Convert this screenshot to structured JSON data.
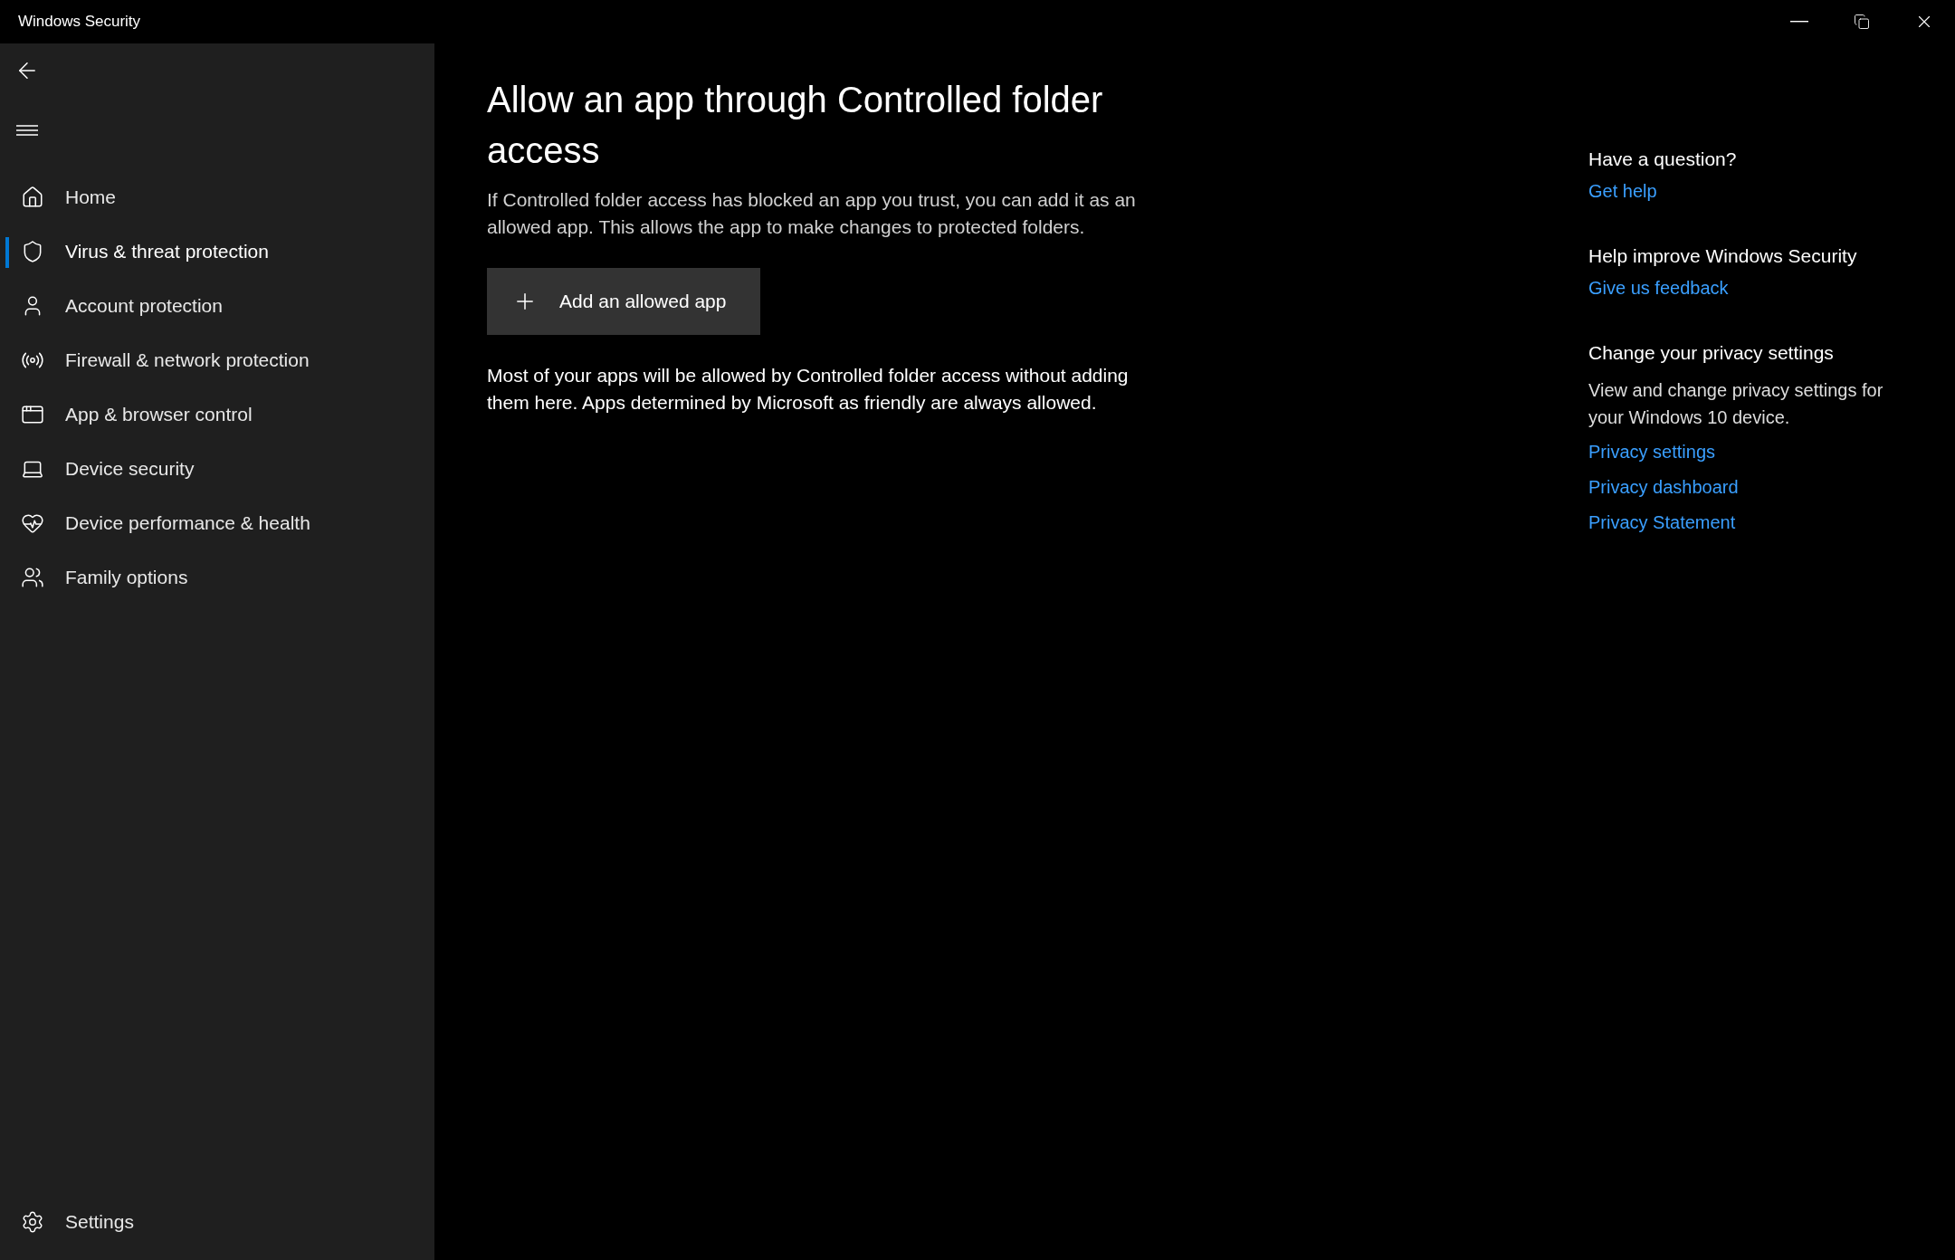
{
  "window": {
    "title": "Windows Security"
  },
  "sidebar": {
    "items": [
      {
        "label": "Home",
        "kind": "home",
        "selected": false
      },
      {
        "label": "Virus & threat protection",
        "kind": "shield",
        "selected": true
      },
      {
        "label": "Account protection",
        "kind": "person",
        "selected": false
      },
      {
        "label": "Firewall & network protection",
        "kind": "antenna",
        "selected": false
      },
      {
        "label": "App & browser control",
        "kind": "window",
        "selected": false
      },
      {
        "label": "Device security",
        "kind": "laptop",
        "selected": false
      },
      {
        "label": "Device performance & health",
        "kind": "heart",
        "selected": false
      },
      {
        "label": "Family options",
        "kind": "people",
        "selected": false
      }
    ],
    "settings": {
      "label": "Settings",
      "selected": false
    }
  },
  "main": {
    "title": "Allow an app through Controlled folder access",
    "description": "If Controlled folder access has blocked an app you trust, you can add it as an allowed app. This allows the app to make changes to protected folders.",
    "button": "Add an allowed app",
    "note": "Most of your apps will be allowed by Controlled folder access without adding them here. Apps determined by Microsoft as friendly are always allowed."
  },
  "aside": [
    {
      "heading": "Have a question?",
      "links": [
        "Get help"
      ]
    },
    {
      "heading": "Help improve Windows Security",
      "links": [
        "Give us feedback"
      ]
    },
    {
      "heading": "Change your privacy settings",
      "text": "View and change privacy settings for your Windows 10 device.",
      "links": [
        "Privacy settings",
        "Privacy dashboard",
        "Privacy Statement"
      ]
    }
  ]
}
